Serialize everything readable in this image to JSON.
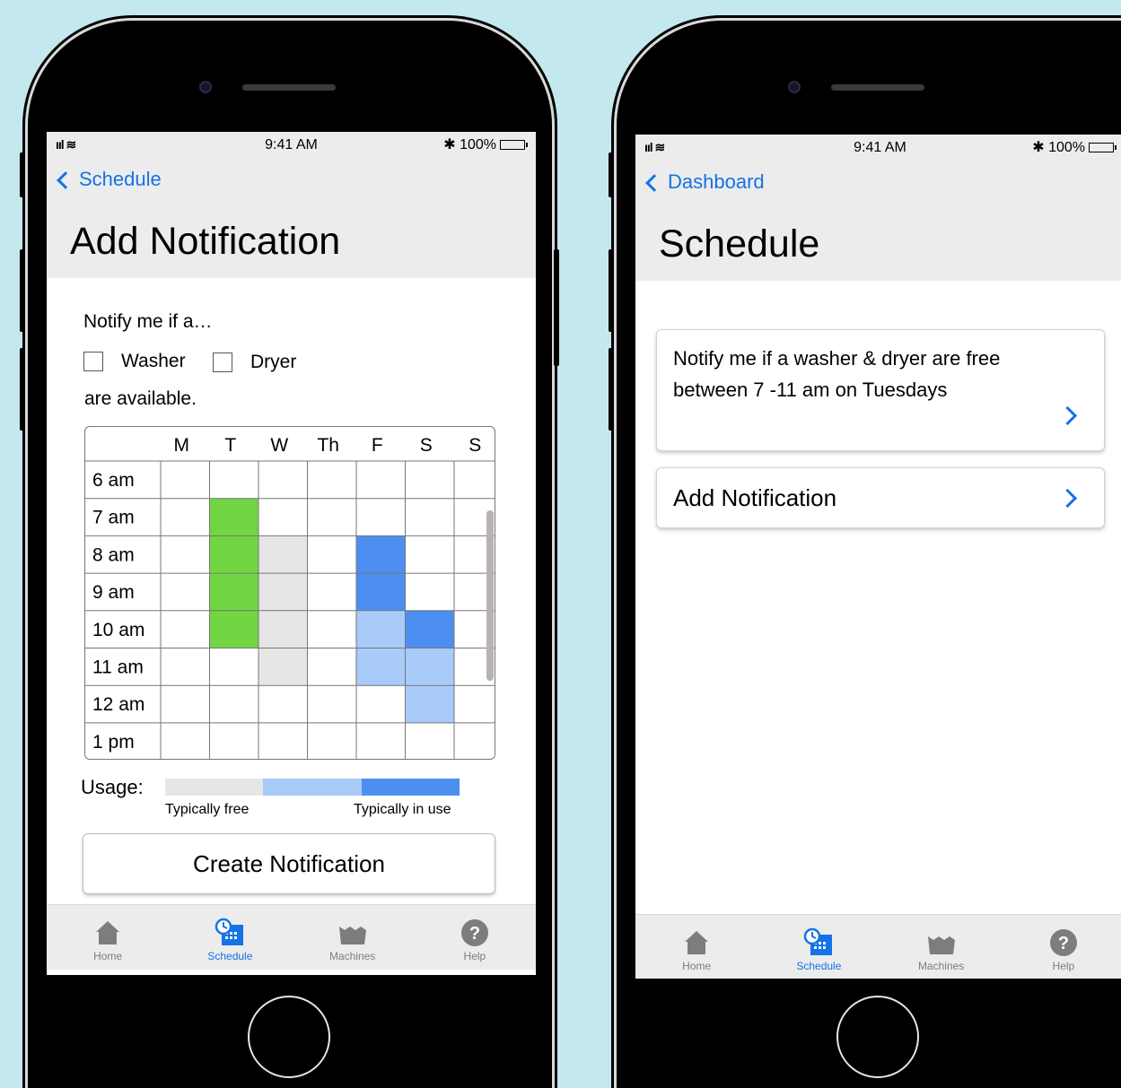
{
  "left_screen": {
    "status": {
      "signal": "ııl ≋",
      "time": "9:41 AM",
      "battery": "✱ 100%"
    },
    "back_label": "Schedule",
    "title": "Add Notification",
    "prompt": "Notify me if a…",
    "checkboxes": [
      {
        "label": "Washer",
        "checked": false
      },
      {
        "label": "Dryer",
        "checked": false
      }
    ],
    "available_text": "are available.",
    "grid": {
      "days": [
        "M",
        "T",
        "W",
        "Th",
        "F",
        "S",
        "S"
      ],
      "hours": [
        "6 am",
        "7 am",
        "8 am",
        "9 am",
        "10 am",
        "11 am",
        "12 am",
        "1 pm"
      ],
      "selection": {
        "day_index": 1,
        "start_hour_index": 1,
        "end_hour_index": 4,
        "color": "#72d544"
      },
      "usage_blocks": [
        {
          "day_index": 2,
          "start_hour_index": 2,
          "end_hour_index": 5,
          "level": "free"
        },
        {
          "day_index": 4,
          "start_hour_index": 2,
          "end_hour_index": 3,
          "level": "in_use"
        },
        {
          "day_index": 4,
          "start_hour_index": 4,
          "end_hour_index": 5,
          "level": "moderate"
        },
        {
          "day_index": 5,
          "start_hour_index": 4,
          "end_hour_index": 4,
          "level": "in_use"
        },
        {
          "day_index": 5,
          "start_hour_index": 5,
          "end_hour_index": 6,
          "level": "moderate"
        }
      ]
    },
    "usage": {
      "label": "Usage:",
      "free_caption": "Typically free",
      "in_use_caption": "Typically in use",
      "colors": {
        "free": "#e6e6e6",
        "moderate": "#a8cbfa",
        "in_use": "#4c8ff0"
      }
    },
    "create_button": "Create Notification",
    "tabs": [
      {
        "label": "Home",
        "icon": "home-icon",
        "active": false
      },
      {
        "label": "Schedule",
        "icon": "schedule-icon",
        "active": true
      },
      {
        "label": "Machines",
        "icon": "machines-icon",
        "active": false
      },
      {
        "label": "Help",
        "icon": "help-icon",
        "active": false
      }
    ]
  },
  "right_screen": {
    "status": {
      "signal": "ııl ≋",
      "time": "9:41 AM",
      "battery": "✱ 100%"
    },
    "back_label": "Dashboard",
    "title": "Schedule",
    "notification_card": {
      "line1": "Notify me if a washer & dryer are free",
      "line2": "between 7 -11 am on Tuesdays"
    },
    "add_card_label": "Add Notification",
    "tabs": [
      {
        "label": "Home",
        "icon": "home-icon",
        "active": false
      },
      {
        "label": "Schedule",
        "icon": "schedule-icon",
        "active": true
      },
      {
        "label": "Machines",
        "icon": "machines-icon",
        "active": false
      },
      {
        "label": "Help",
        "icon": "help-icon",
        "active": false
      }
    ]
  },
  "colors": {
    "accent": "#1473e6",
    "page_bg": "#c3e8ee",
    "header_bg": "#ececec"
  }
}
